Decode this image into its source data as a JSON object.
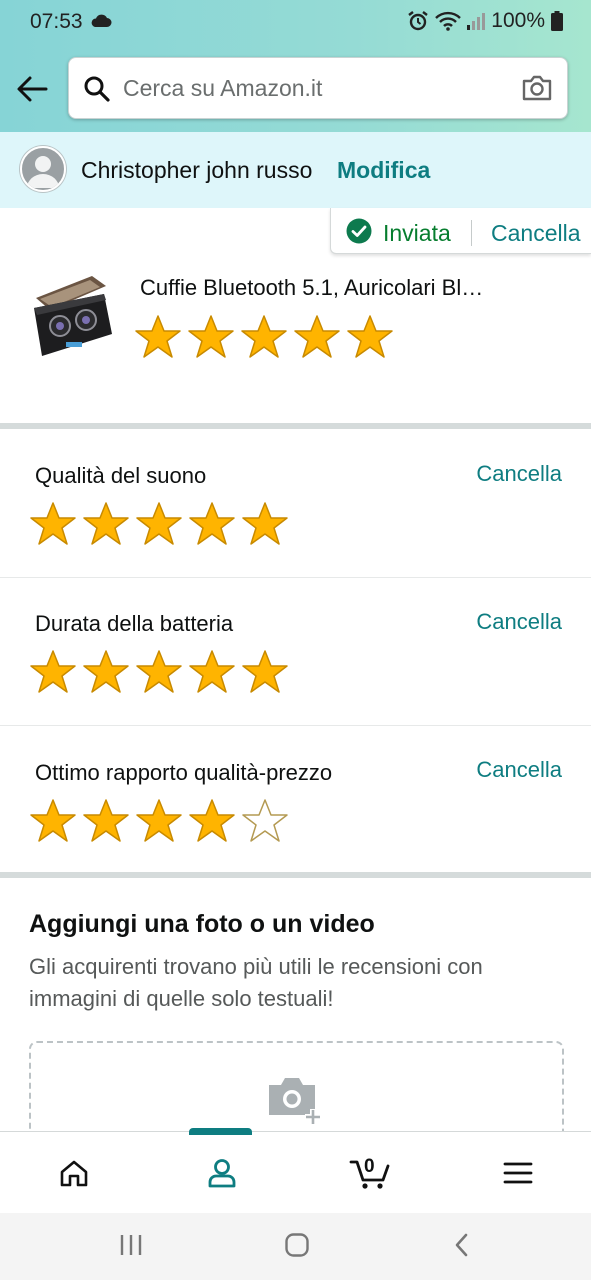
{
  "status_bar": {
    "time": "07:53",
    "battery": "100%"
  },
  "search": {
    "placeholder": "Cerca su Amazon.it"
  },
  "profile": {
    "name": "Christopher john russo",
    "edit_label": "Modifica"
  },
  "review_status": {
    "sent_label": "Inviata",
    "cancel_label": "Cancella"
  },
  "product": {
    "title": "Cuffie Bluetooth 5.1, Auricolari Bl…",
    "rating": 5,
    "max_rating": 5
  },
  "attributes": [
    {
      "label": "Qualità del suono",
      "cancel_label": "Cancella",
      "rating": 5
    },
    {
      "label": "Durata della batteria",
      "cancel_label": "Cancella",
      "rating": 5
    },
    {
      "label": "Ottimo rapporto qualità-prezzo",
      "cancel_label": "Cancella",
      "rating": 4
    }
  ],
  "media": {
    "title": "Aggiungi una foto o un video",
    "description": "Gli acquirenti trovano più utili le recensioni con immagini di quelle solo testuali!"
  },
  "bottom_nav": {
    "cart_count": "0",
    "active_tab": "profile"
  },
  "colors": {
    "accent": "#0e7d81",
    "star_fill": "#ffb400",
    "sent_green": "#067d2e",
    "header_gradient_start": "#86d4d6",
    "header_gradient_end": "#a6e6cf"
  }
}
